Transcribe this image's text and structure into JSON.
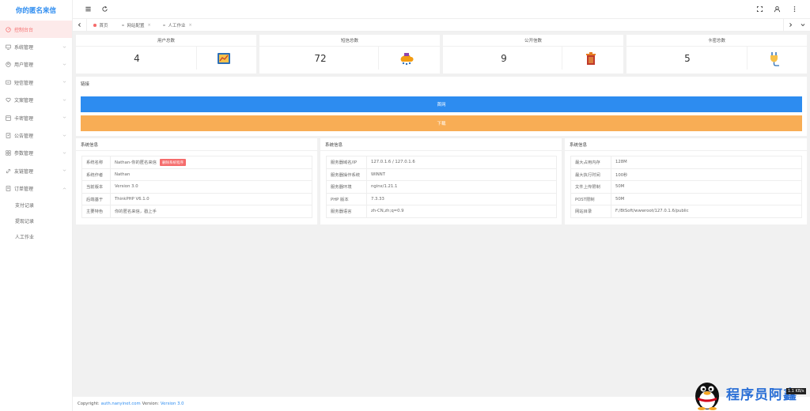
{
  "app": {
    "title": "你的匿名来信"
  },
  "sidebar": {
    "items": [
      {
        "label": "控制台台",
        "icon": "dashboard-icon",
        "active": true
      },
      {
        "label": "系统管理",
        "icon": "monitor-icon"
      },
      {
        "label": "用户管理",
        "icon": "user-icon"
      },
      {
        "label": "短信管理",
        "icon": "message-icon"
      },
      {
        "label": "文案管理",
        "icon": "heart-icon"
      },
      {
        "label": "卡密管理",
        "icon": "card-icon"
      },
      {
        "label": "公告管理",
        "icon": "notice-icon"
      },
      {
        "label": "参数管理",
        "icon": "grid-icon"
      },
      {
        "label": "友链管理",
        "icon": "link-icon"
      },
      {
        "label": "订单管理",
        "icon": "order-icon",
        "expanded": true
      }
    ],
    "subitems": [
      "支付记录",
      "提现记录",
      "人工作业"
    ]
  },
  "tabs": [
    {
      "label": "首页"
    },
    {
      "label": "网站配置"
    },
    {
      "label": "人工作业"
    }
  ],
  "stats": [
    {
      "title": "用户总数",
      "value": "4"
    },
    {
      "title": "短信总数",
      "value": "72"
    },
    {
      "title": "公开信数",
      "value": "9"
    },
    {
      "title": "卡密总数",
      "value": "5"
    }
  ],
  "links": {
    "title": "链接",
    "home_label": "首网",
    "download_label": "下载",
    "home_color": "#2d8cf0",
    "download_color": "#f8ad55"
  },
  "panels": [
    {
      "title": "系统信息",
      "rows": [
        {
          "k": "系统名称",
          "v": "Nathan-你的匿名来信",
          "badge": "删除系统程序"
        },
        {
          "k": "系统作者",
          "v": "Nathan"
        },
        {
          "k": "当前版本",
          "v": "Version 3.0"
        },
        {
          "k": "后端基于",
          "v": "ThinkPHP V6.1.0"
        },
        {
          "k": "主要特色",
          "v": "你的匿名来信，戳上手"
        }
      ]
    },
    {
      "title": "系统信息",
      "rows": [
        {
          "k": "服务器域名/IP",
          "v": "127.0.1.6 / 127.0.1.6"
        },
        {
          "k": "服务器操作系统",
          "v": "WINNT"
        },
        {
          "k": "服务器环境",
          "v": "nginx/1.21.1"
        },
        {
          "k": "PHP 版本",
          "v": "7.3.33"
        },
        {
          "k": "服务器语言",
          "v": "zh-CN,zh;q=0.9"
        }
      ]
    },
    {
      "title": "系统信息",
      "rows": [
        {
          "k": "最大占用内存",
          "v": "128M"
        },
        {
          "k": "最大执行时间",
          "v": "100秒"
        },
        {
          "k": "文件上传限制",
          "v": "50M"
        },
        {
          "k": "POST限制",
          "v": "50M"
        },
        {
          "k": "网站目录",
          "v": "F:/BtSoft/wwwroot/127.0.1.6/public"
        }
      ]
    }
  ],
  "footer": {
    "prefix": "Copyright:",
    "link": "auth.nanyinet.com",
    "version_label": "Version:",
    "version": "Version 3.0"
  },
  "watermark": {
    "text": "程序员阿鑫",
    "badge": "1.1 KB/s"
  }
}
